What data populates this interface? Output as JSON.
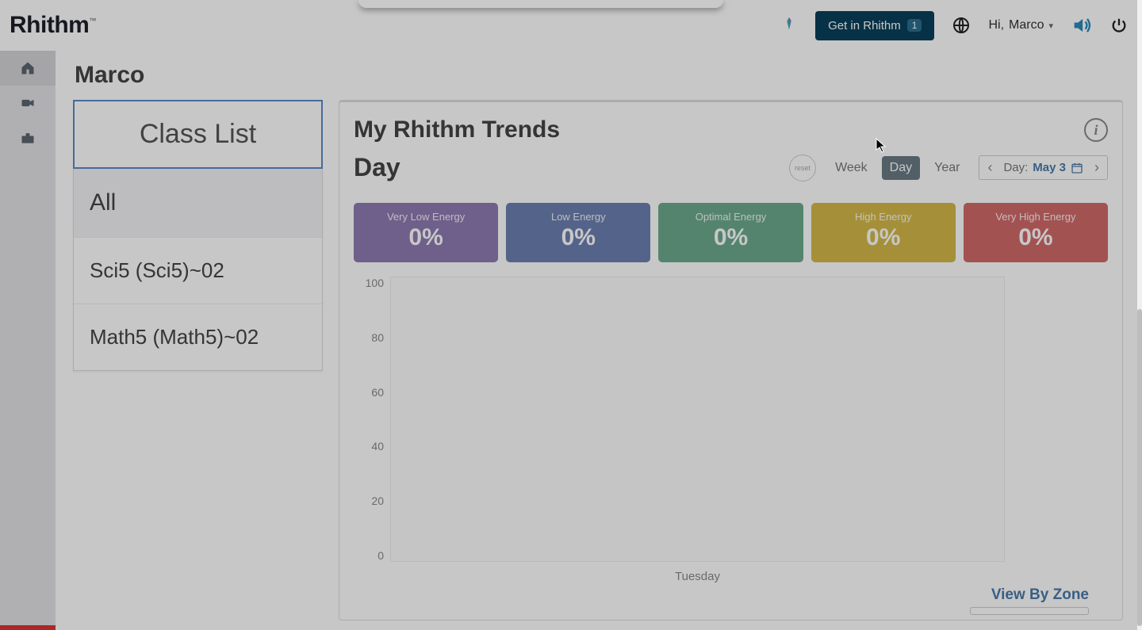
{
  "header": {
    "logo_text": "Rhithm",
    "get_in_label": "Get in Rhithm",
    "get_in_badge": "1",
    "user_prefix": "Hi,",
    "user_name": "Marco"
  },
  "sidebar": {
    "items": [
      "home",
      "video",
      "toolbox"
    ]
  },
  "page": {
    "title": "Marco"
  },
  "class_list": {
    "title": "Class List",
    "items": [
      "All",
      "Sci5 (Sci5)~02",
      "Math5 (Math5)~02"
    ]
  },
  "trends": {
    "title": "My Rhithm Trends",
    "period_label": "Day",
    "tabs": [
      "Week",
      "Day",
      "Year"
    ],
    "active_tab": "Day",
    "date_label": "Day:",
    "date_value": "May 3",
    "view_by_zone": "View By Zone"
  },
  "energy": [
    {
      "label": "Very Low Energy",
      "value": "0%",
      "cls": "ec-purple"
    },
    {
      "label": "Low Energy",
      "value": "0%",
      "cls": "ec-blue"
    },
    {
      "label": "Optimal Energy",
      "value": "0%",
      "cls": "ec-green"
    },
    {
      "label": "High Energy",
      "value": "0%",
      "cls": "ec-yellow"
    },
    {
      "label": "Very High Energy",
      "value": "0%",
      "cls": "ec-red"
    }
  ],
  "chart_data": {
    "type": "bar",
    "categories": [
      "Tuesday"
    ],
    "series": [
      {
        "name": "Very Low Energy",
        "values": [
          0
        ]
      },
      {
        "name": "Low Energy",
        "values": [
          0
        ]
      },
      {
        "name": "Optimal Energy",
        "values": [
          0
        ]
      },
      {
        "name": "High Energy",
        "values": [
          0
        ]
      },
      {
        "name": "Very High Energy",
        "values": [
          0
        ]
      }
    ],
    "ylabel": "",
    "xlabel": "",
    "ylim": [
      0,
      100
    ],
    "yticks": [
      100,
      80,
      60,
      40,
      20,
      0
    ]
  }
}
